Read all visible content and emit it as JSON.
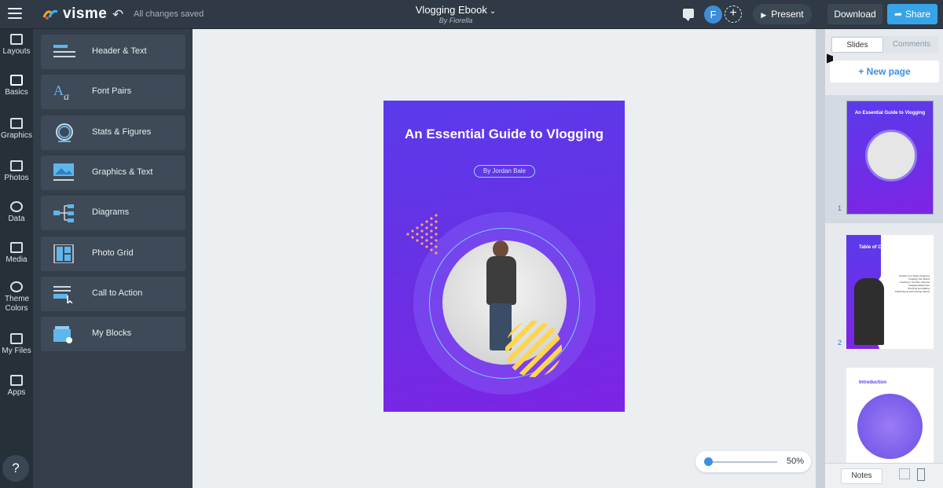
{
  "app": {
    "logo_text": "visme",
    "saved_status": "All changes saved"
  },
  "document": {
    "title": "Vlogging Ebook",
    "author": "By Fiorella"
  },
  "user": {
    "avatar_initial": "F"
  },
  "toolbar": {
    "present_label": "Present",
    "download_label": "Download",
    "share_label": "Share"
  },
  "rail": {
    "items": [
      {
        "label": "Layouts"
      },
      {
        "label": "Basics"
      },
      {
        "label": "Graphics"
      },
      {
        "label": "Photos"
      },
      {
        "label": "Data"
      },
      {
        "label": "Media"
      },
      {
        "label": "Theme Colors"
      },
      {
        "label": "My Files"
      },
      {
        "label": "Apps"
      }
    ],
    "help_label": "?"
  },
  "blocks": {
    "items": [
      {
        "label": "Header & Text"
      },
      {
        "label": "Font Pairs"
      },
      {
        "label": "Stats & Figures"
      },
      {
        "label": "Graphics & Text"
      },
      {
        "label": "Diagrams"
      },
      {
        "label": "Photo Grid"
      },
      {
        "label": "Call to Action"
      },
      {
        "label": "My Blocks"
      }
    ]
  },
  "cover": {
    "title": "An Essential Guide to Vlogging",
    "author_tag": "By Jordan Bale"
  },
  "zoom": {
    "level_label": "50%",
    "level": 0.5
  },
  "slides_panel": {
    "tab_slides": "Slides",
    "tab_comments": "Comments",
    "new_page_label": "+ New page",
    "thumbs": [
      {
        "number": "1",
        "title": "An Essential Guide to Vlogging"
      },
      {
        "number": "2",
        "title": "Table of Contents",
        "items": [
          "Finding Your Target Audience",
          "Creating Your Brand",
          "Creating a YouTube Channel",
          "Vlogging Equipment",
          "Shooting and Editing",
          "Publishing and Promoting Videos"
        ]
      },
      {
        "number": "",
        "title": "Introduction"
      }
    ],
    "notes_label": "Notes"
  },
  "colors": {
    "accent": "#38a4e8",
    "brand_purple": "#6a2fe4",
    "dark_bg": "#2f3a46"
  }
}
